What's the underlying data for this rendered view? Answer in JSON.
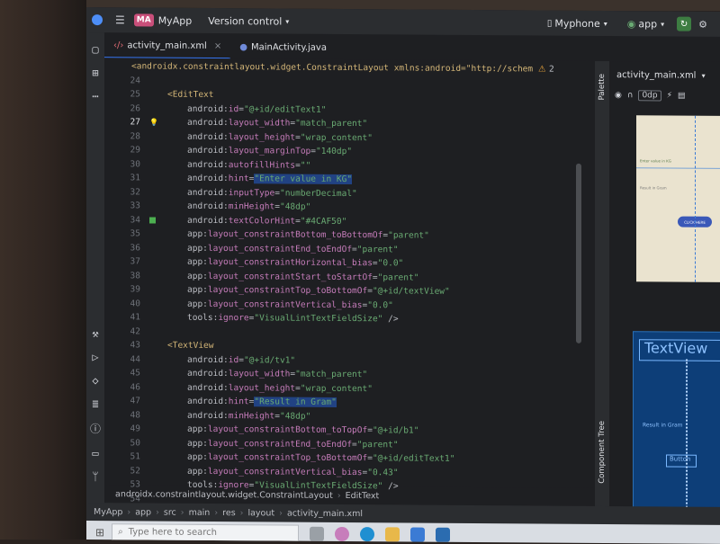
{
  "titlebar": {
    "project_badge": "MA",
    "project_name": "MyApp",
    "version_control": "Version control",
    "device": "Myphone",
    "run_config": "app"
  },
  "tabs": [
    {
      "label": "activity_main.xml",
      "active": true
    },
    {
      "label": "MainActivity.java",
      "active": false
    }
  ],
  "editor": {
    "lines": [
      {
        "n": "",
        "text": "<androidx.constraintlayout.widget.ConstraintLayout xmlns:android=\"http://schem",
        "kind": "header"
      },
      {
        "n": "24",
        "text": "",
        "kind": "plain"
      },
      {
        "n": "25",
        "text": "<EditText",
        "kind": "tag",
        "indent": 0
      },
      {
        "n": "26",
        "ns": "android:",
        "attr": "id",
        "val": "\"@+id/editText1\"",
        "indent": 1
      },
      {
        "n": "27",
        "ns": "android:",
        "attr": "layout_width",
        "val": "\"match_parent\"",
        "indent": 1,
        "current": true
      },
      {
        "n": "28",
        "ns": "android:",
        "attr": "layout_height",
        "val": "\"wrap_content\"",
        "indent": 1
      },
      {
        "n": "29",
        "ns": "android:",
        "attr": "layout_marginTop",
        "val": "\"140dp\"",
        "indent": 1
      },
      {
        "n": "30",
        "ns": "android:",
        "attr": "autofillHints",
        "val": "\"\"",
        "indent": 1
      },
      {
        "n": "31",
        "ns": "android:",
        "attr": "hint",
        "val": "\"Enter value in KG\"",
        "indent": 1,
        "highlight": true
      },
      {
        "n": "32",
        "ns": "android:",
        "attr": "inputType",
        "val": "\"numberDecimal\"",
        "indent": 1
      },
      {
        "n": "33",
        "ns": "android:",
        "attr": "minHeight",
        "val": "\"48dp\"",
        "indent": 1
      },
      {
        "n": "34",
        "ns": "android:",
        "attr": "textColorHint",
        "val": "\"#4CAF50\"",
        "indent": 1
      },
      {
        "n": "35",
        "ns": "app:",
        "attr": "layout_constraintBottom_toBottomOf",
        "val": "\"parent\"",
        "indent": 1
      },
      {
        "n": "36",
        "ns": "app:",
        "attr": "layout_constraintEnd_toEndOf",
        "val": "\"parent\"",
        "indent": 1
      },
      {
        "n": "37",
        "ns": "app:",
        "attr": "layout_constraintHorizontal_bias",
        "val": "\"0.0\"",
        "indent": 1
      },
      {
        "n": "38",
        "ns": "app:",
        "attr": "layout_constraintStart_toStartOf",
        "val": "\"parent\"",
        "indent": 1
      },
      {
        "n": "39",
        "ns": "app:",
        "attr": "layout_constraintTop_toBottomOf",
        "val": "\"@+id/textView\"",
        "indent": 1
      },
      {
        "n": "40",
        "ns": "app:",
        "attr": "layout_constraintVertical_bias",
        "val": "\"0.0\"",
        "indent": 1
      },
      {
        "n": "41",
        "ns": "tools:",
        "attr": "ignore",
        "val": "\"VisualLintTextFieldSize\"",
        "tail": " />",
        "indent": 1
      },
      {
        "n": "42",
        "text": "",
        "kind": "plain"
      },
      {
        "n": "43",
        "text": "<TextView",
        "kind": "tag",
        "indent": 0
      },
      {
        "n": "44",
        "ns": "android:",
        "attr": "id",
        "val": "\"@+id/tv1\"",
        "indent": 1
      },
      {
        "n": "45",
        "ns": "android:",
        "attr": "layout_width",
        "val": "\"match_parent\"",
        "indent": 1
      },
      {
        "n": "46",
        "ns": "android:",
        "attr": "layout_height",
        "val": "\"wrap_content\"",
        "indent": 1
      },
      {
        "n": "47",
        "ns": "android:",
        "attr": "hint",
        "val": "\"Result in Gram\"",
        "indent": 1,
        "highlight": true
      },
      {
        "n": "48",
        "ns": "android:",
        "attr": "minHeight",
        "val": "\"48dp\"",
        "indent": 1
      },
      {
        "n": "49",
        "ns": "app:",
        "attr": "layout_constraintBottom_toTopOf",
        "val": "\"@+id/b1\"",
        "indent": 1
      },
      {
        "n": "50",
        "ns": "app:",
        "attr": "layout_constraintEnd_toEndOf",
        "val": "\"parent\"",
        "indent": 1
      },
      {
        "n": "51",
        "ns": "app:",
        "attr": "layout_constraintTop_toBottomOf",
        "val": "\"@+id/editText1\"",
        "indent": 1
      },
      {
        "n": "52",
        "ns": "app:",
        "attr": "layout_constraintVertical_bias",
        "val": "\"0.43\"",
        "indent": 1
      },
      {
        "n": "53",
        "ns": "tools:",
        "attr": "ignore",
        "val": "\"VisualLintTextFieldSize\"",
        "tail": " />",
        "indent": 1
      },
      {
        "n": "54",
        "text": "",
        "kind": "plain"
      }
    ],
    "warning_count": "2"
  },
  "breadcrumbs": [
    "androidx.constraintlayout.widget.ConstraintLayout",
    "EditText"
  ],
  "statusbar": [
    "MyApp",
    "app",
    "src",
    "main",
    "res",
    "layout",
    "activity_main.xml"
  ],
  "right_panel": {
    "palette_label": "Palette",
    "component_tree_label": "Component Tree",
    "design_tab": "activity_main.xml",
    "dp_value": "0dp",
    "preview_hint": "Enter value in KG",
    "preview_result": "Result in Gram",
    "preview_button": "CLICK HERE",
    "blueprint_textview": "TextView",
    "blueprint_button": "Button"
  },
  "taskbar": {
    "search_placeholder": "Type here to search"
  },
  "colors": {
    "accent": "#3574f0",
    "tag": "#d5b778",
    "attr": "#c77dbb",
    "value": "#6aab73",
    "blueprint": "#0d3e78"
  }
}
